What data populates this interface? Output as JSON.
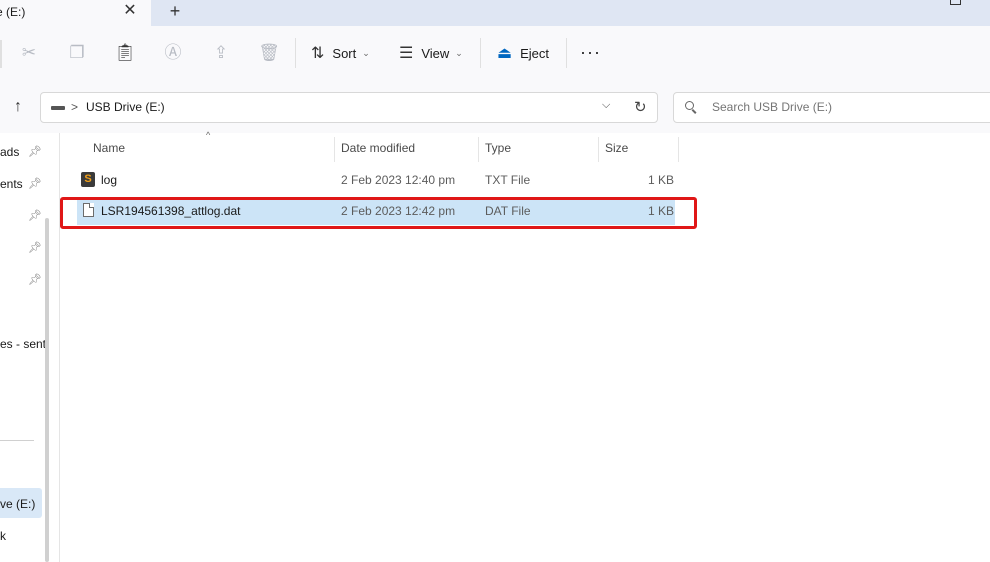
{
  "tab": {
    "title": "e (E:)",
    "close": "✕",
    "new": "+"
  },
  "toolbar": {
    "sort_label": "Sort",
    "view_label": "View",
    "eject_label": "Eject",
    "more": "···"
  },
  "address": {
    "separator": ">",
    "crumb": "USB Drive (E:)"
  },
  "search": {
    "placeholder": "Search USB Drive (E:)"
  },
  "nav": {
    "items": [
      "ads",
      "ents",
      "es - sent",
      "ve (E:)",
      "k"
    ]
  },
  "columns": {
    "name": "Name",
    "date": "Date modified",
    "type": "Type",
    "size": "Size"
  },
  "files": [
    {
      "name": "log",
      "date": "2 Feb 2023 12:40 pm",
      "type": "TXT File",
      "size": "1 KB",
      "icon": "sublime-text-icon"
    },
    {
      "name": "LSR194561398_attlog.dat",
      "date": "2 Feb 2023 12:42 pm",
      "type": "DAT File",
      "size": "1 KB",
      "icon": "file-icon",
      "selected": true
    }
  ],
  "colors": {
    "selection": "#cce4f7",
    "highlight": "#e01717",
    "accent": "#0067c0"
  }
}
